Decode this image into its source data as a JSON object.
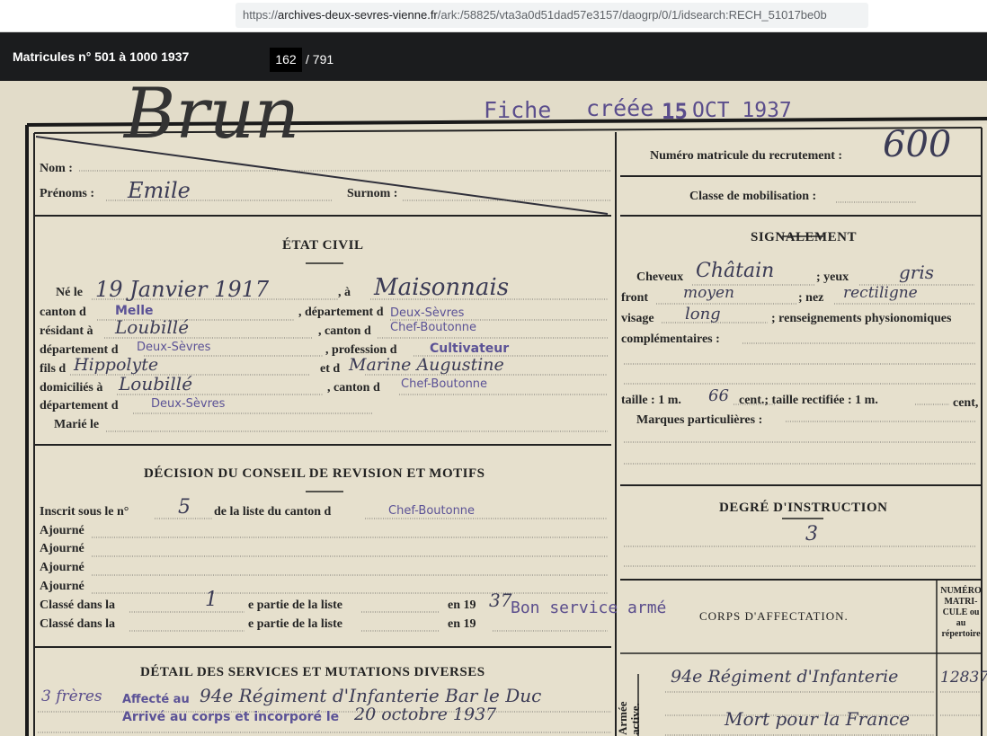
{
  "browser": {
    "url_host": "archives-deux-sevres-vienne.fr",
    "url_path": "/ark:/58825/vta3a0d51dad57e3157/daogrp/0/1/idsearch:RECH_51017be0b",
    "url_scheme": "https://"
  },
  "viewer": {
    "title": "Matricules n° 501 à 1000 1937",
    "current_page": "162",
    "total_pages": "/ 791"
  },
  "document": {
    "stamp_fiche": "Fiche",
    "stamp_creee": "créée",
    "stamp_date_day": "15",
    "stamp_date": "OCT 1937",
    "matricule_label": "Numéro matricule du recrutement :",
    "matricule_value": "600",
    "classe_mobilisation_label": "Classe de mobilisation :",
    "nom_label": "Nom :",
    "nom_value": "Brun",
    "prenoms_label": "Prénoms :",
    "prenoms_value": "Emile",
    "surnom_label": "Surnom :",
    "etat_civil_header": "ÉTAT CIVIL",
    "ne_le_label": "Né le",
    "ne_le_value": "19 Janvier 1917",
    "a_label": ", à",
    "lieu_naissance": "Maisonnais",
    "canton_label": "canton d",
    "canton_value": "Melle",
    "departement_label": ", département d",
    "departement_value": "Deux-Sèvres",
    "residant_label": "résidant à",
    "residant_value": "Loubillé",
    "canton2_label": ", canton d",
    "canton2_value": "Chef-Boutonne",
    "departement2_label": "département d",
    "departement2_value": "Deux-Sèvres",
    "profession_label": ", profession d",
    "profession_value": "Cultivateur",
    "fils_label": "fils d",
    "pere_value": "Hippolyte",
    "et_de_label": "et d",
    "mere_value": "Marine Augustine",
    "domicilies_label": "domiciliés à",
    "domicilies_value": "Loubillé",
    "canton3_label": ", canton d",
    "canton3_value": "Chef-Boutonne",
    "departement3_label": "département d",
    "departement3_value": "Deux-Sèvres",
    "marie_label": "Marié le",
    "signalement_header": "SIGNALEMENT",
    "cheveux_label": "Cheveux",
    "cheveux_value": "Châtain",
    "yeux_label": "; yeux",
    "yeux_value": "gris",
    "front_label": "front",
    "front_value": "moyen",
    "nez_label": "; nez",
    "nez_value": "rectiligne",
    "visage_label": "visage",
    "visage_value": "long",
    "renseignements_label": "; renseignements physionomiques",
    "complementaires_label": "complémentaires :",
    "taille_label": "taille : 1 m.",
    "taille_value": "66",
    "taille_cent_label": "cent.; taille rectifiée : 1 m.",
    "taille_cent2_label": "cent,",
    "marques_label": "Marques particulières :",
    "decision_header": "DÉCISION DU CONSEIL DE REVISION ET MOTIFS",
    "inscrit_label": "Inscrit sous le n°",
    "inscrit_value": "5",
    "de_la_liste_label": "de la liste du canton d",
    "de_la_liste_value": "Chef-Boutonne",
    "ajourne_label": "Ajourné",
    "classe_dans_label": "Classé dans la",
    "classe_partie_value": "1",
    "partie_label": "e partie de la liste",
    "en19_label": "en 19",
    "en19_value": "37",
    "bon_service_stamp": "Bon service armé",
    "degre_header": "DEGRÉ D'INSTRUCTION",
    "degre_value": "3",
    "corps_header": "CORPS D'AFFECTATION.",
    "numero_header": "NUMÉRO MATRI- CULE ou au répertoire",
    "armee_active_label": "Armée active.",
    "corps_value": "94e Régiment d'Infanterie",
    "numero_value": "12837",
    "mort_value": "Mort pour la France",
    "detail_header": "DÉTAIL DES SERVICES ET MUTATIONS DIVERSES",
    "freres_value": "3 frères",
    "affecte_stamp": "Affecté au",
    "affecte_value": "94e Régiment d'Infanterie Bar le Duc",
    "arrive_stamp": "Arrivé au corps et incorporé le",
    "arrive_value": "20 octobre 1937"
  }
}
